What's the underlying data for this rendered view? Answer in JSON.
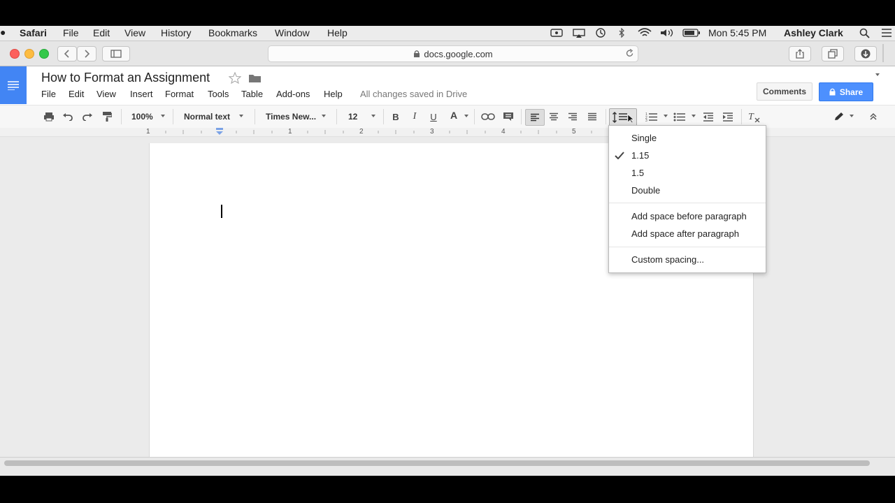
{
  "mac_menu": {
    "app": "Safari",
    "items": [
      "File",
      "Edit",
      "View",
      "History",
      "Bookmarks",
      "Window",
      "Help"
    ],
    "clock": "Mon 5:45 PM",
    "user": "Ashley Clark"
  },
  "safari": {
    "url": "docs.google.com"
  },
  "docs": {
    "title": "How to Format an Assignment",
    "menu": [
      "File",
      "Edit",
      "View",
      "Insert",
      "Format",
      "Tools",
      "Table",
      "Add-ons",
      "Help"
    ],
    "save_status": "All changes saved in Drive",
    "comments_label": "Comments",
    "share_label": "Share",
    "toolbar": {
      "zoom": "100%",
      "style": "Normal text",
      "font": "Times New...",
      "size": "12",
      "bold": "B",
      "italic": "I",
      "underline": "U",
      "text_color": "A"
    },
    "ruler_numbers": [
      "1",
      "1",
      "2",
      "3",
      "4",
      "5"
    ]
  },
  "line_spacing_menu": {
    "items": [
      "Single",
      "1.15",
      "1.5",
      "Double"
    ],
    "checked": "1.15",
    "paragraph_items": [
      "Add space before paragraph",
      "Add space after paragraph"
    ],
    "custom": "Custom spacing..."
  },
  "colors": {
    "docs_blue": "#4285f4",
    "share_blue": "#4d90fe",
    "text_color_bar": "#000000"
  }
}
